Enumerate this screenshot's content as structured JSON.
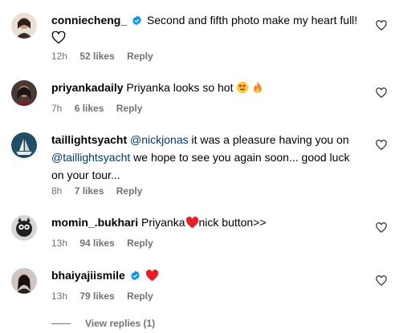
{
  "comments": [
    {
      "username": "conniecheng_",
      "verified": true,
      "text": "Second and fifth photo make my heart full!",
      "time": "12h",
      "likes": "52 likes",
      "reply": "Reply"
    },
    {
      "username": "priyankadaily",
      "verified": false,
      "text": "Priyanka looks so hot",
      "time": "7h",
      "likes": "6 likes",
      "reply": "Reply"
    },
    {
      "username": "taillightsyacht",
      "verified": false,
      "mention1": "@nickjonas",
      "text1": " it was a pleasure having you on ",
      "mention2": "@taillightsyacht",
      "text2": " we hope to see you again soon... good luck on your tour...",
      "time": "8h",
      "likes": "7 likes",
      "reply": "Reply"
    },
    {
      "username": "momin_.bukhari",
      "verified": false,
      "text_before": "Priyanka",
      "text_after": "nick button>>",
      "time": "13h",
      "likes": "94 likes",
      "reply": "Reply"
    },
    {
      "username": "bhaiyajiismile",
      "verified": true,
      "text": "",
      "time": "13h",
      "likes": "79 likes",
      "reply": "Reply"
    }
  ],
  "view_replies": "View replies (1)",
  "colors": {
    "verified": "#0095f6",
    "heart_red": "#ed1c24",
    "meta": "#737373",
    "mention": "#00376b"
  },
  "icons": [
    "verified-badge-icon",
    "heart-outline-icon",
    "heart-emoji-icon",
    "heart-eyes-emoji-icon",
    "fire-emoji-icon",
    "like-heart-icon"
  ]
}
